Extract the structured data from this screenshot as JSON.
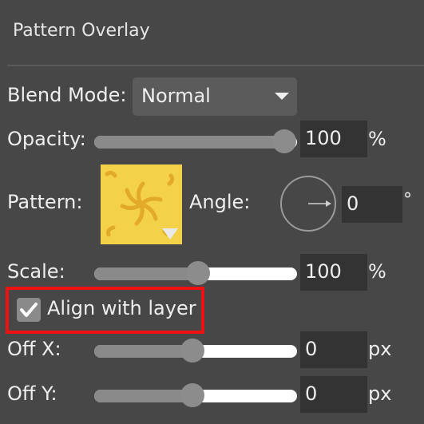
{
  "panel": {
    "title": "Pattern Overlay"
  },
  "blend_mode": {
    "label": "Blend Mode:",
    "value": "Normal"
  },
  "opacity": {
    "label": "Opacity:",
    "value": "100",
    "unit": "%",
    "level": 1.0
  },
  "pattern": {
    "label": "Pattern:",
    "colors": {
      "base": "#f3d24a",
      "swirl": "#e3a92a"
    }
  },
  "angle": {
    "label": "Angle:",
    "value": "0",
    "unit": "°"
  },
  "scale": {
    "label": "Scale:",
    "value": "100",
    "unit": "%",
    "level": 0.53
  },
  "align": {
    "label": "Align with layer",
    "checked": true
  },
  "off_x": {
    "label": "Off X:",
    "value": "0",
    "unit": "px",
    "level": 0.5
  },
  "off_y": {
    "label": "Off Y:",
    "value": "0",
    "unit": "px",
    "level": 0.5
  }
}
